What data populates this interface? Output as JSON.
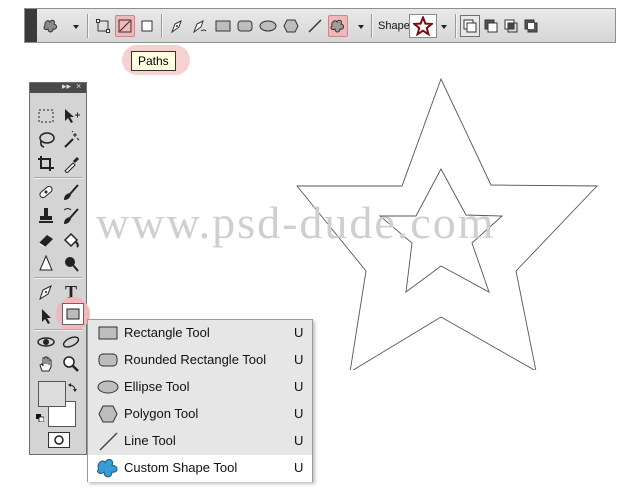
{
  "tooltip": {
    "text": "Paths"
  },
  "options_bar": {
    "shape_label": "Shape:",
    "buttons": [
      "tool-preset-picker",
      "shape-layers-mode",
      "paths-mode",
      "fill-pixels-mode",
      "pen-tool",
      "freeform-pen-tool",
      "rectangle-tool",
      "rounded-rectangle-tool",
      "ellipse-tool",
      "polygon-tool",
      "line-tool",
      "custom-shape-tool",
      "shape-picker",
      "add-to-shape-area",
      "subtract-from-shape-area",
      "intersect-shape-areas",
      "exclude-overlapping-shape-areas"
    ]
  },
  "tools_panel": {
    "header_expand": "▸▸",
    "header_close": "×",
    "type_tool_label": "T"
  },
  "flyout_menu": {
    "items": [
      {
        "label": "Rectangle Tool",
        "key": "U",
        "icon": "rectangle-icon"
      },
      {
        "label": "Rounded Rectangle Tool",
        "key": "U",
        "icon": "rounded-rectangle-icon"
      },
      {
        "label": "Ellipse Tool",
        "key": "U",
        "icon": "ellipse-icon"
      },
      {
        "label": "Polygon Tool",
        "key": "U",
        "icon": "polygon-icon"
      },
      {
        "label": "Line Tool",
        "key": "U",
        "icon": "line-icon"
      },
      {
        "label": "Custom Shape Tool",
        "key": "U",
        "icon": "custom-shape-icon",
        "selected": true
      }
    ]
  },
  "canvas": {
    "watermark": "www.psd-dude.com",
    "shape": "star-paths"
  },
  "colors": {
    "active_highlight": "#f2b7b9",
    "panel_bg": "#d4d4d4",
    "menu_bg": "#e6e6e6",
    "custom_shape_icon": "#3a9bd5"
  }
}
